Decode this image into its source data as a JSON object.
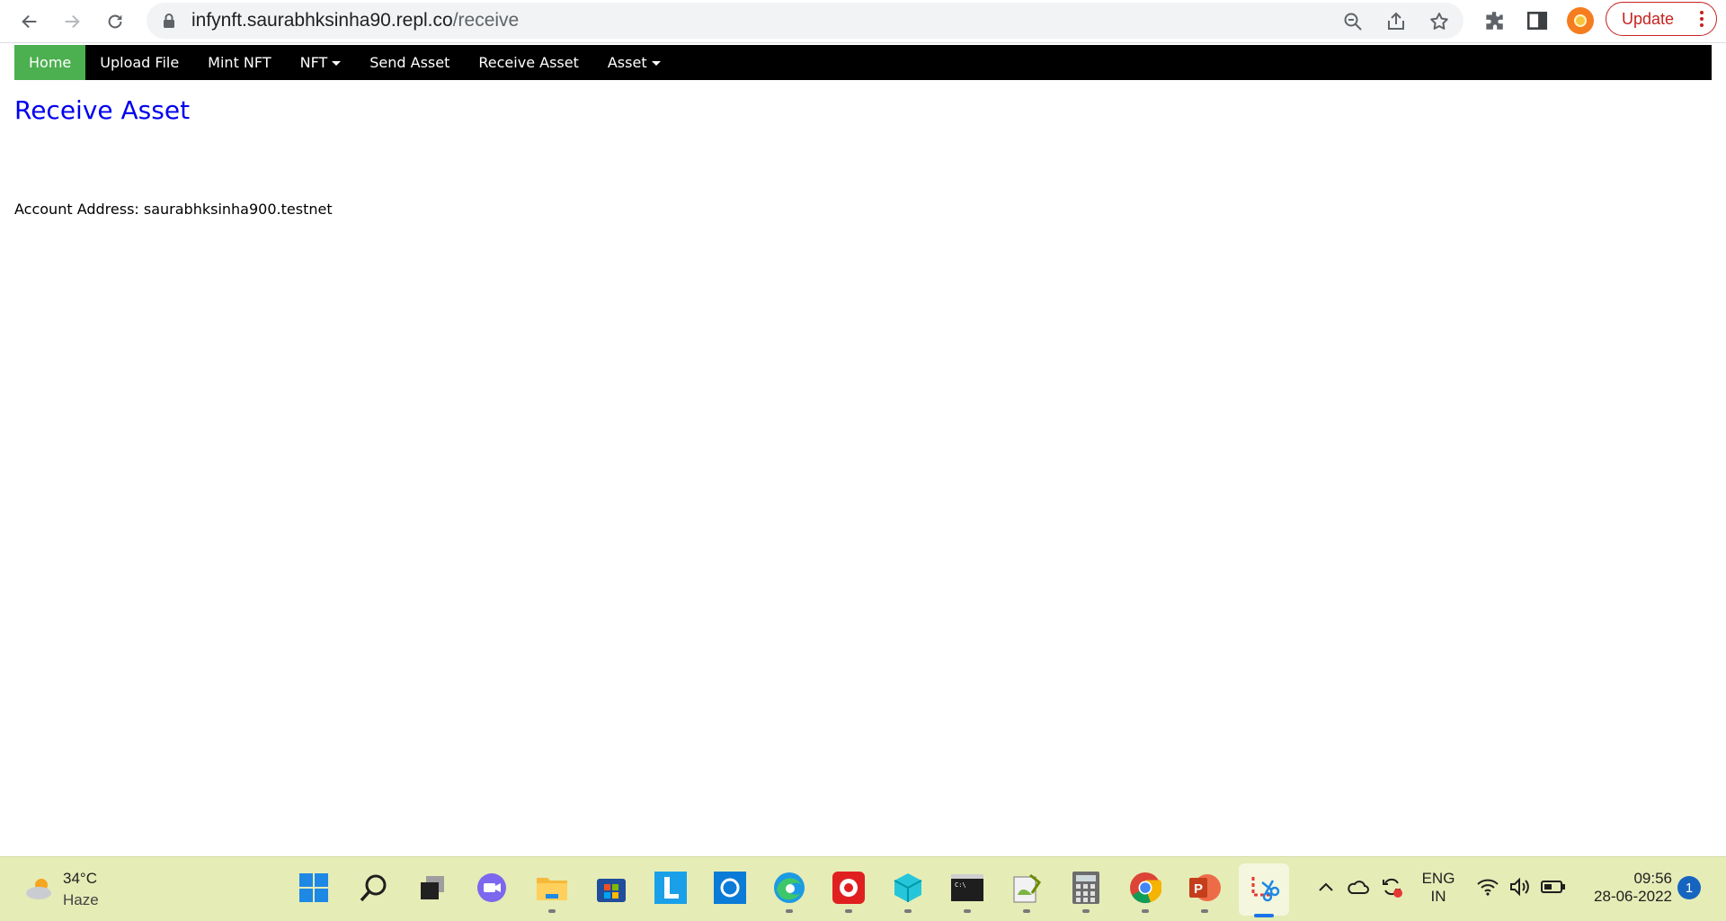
{
  "browser": {
    "url_host": "infynft.saurabhksinha90.repl.co",
    "url_path": "/receive",
    "update_label": "Update"
  },
  "nav": {
    "items": [
      {
        "label": "Home",
        "active": true
      },
      {
        "label": "Upload File"
      },
      {
        "label": "Mint NFT"
      },
      {
        "label": "NFT",
        "dropdown": true
      },
      {
        "label": "Send Asset"
      },
      {
        "label": "Receive Asset"
      },
      {
        "label": "Asset",
        "dropdown": true
      }
    ]
  },
  "page": {
    "title": "Receive Asset",
    "account_label": "Account Address:",
    "account_value": "saurabhksinha900.testnet"
  },
  "taskbar": {
    "weather": {
      "temp": "34°C",
      "condition": "Haze"
    },
    "apps": [
      "windows-start",
      "search",
      "task-view",
      "teams-chat",
      "file-explorer",
      "microsoft-store",
      "app-L",
      "cortana",
      "edge",
      "screen-recorder",
      "3d-viewer",
      "terminal",
      "notepad-plus",
      "calculator",
      "chrome",
      "powerpoint",
      "snipping-tool"
    ],
    "language": {
      "line1": "ENG",
      "line2": "IN"
    },
    "clock": {
      "time": "09:56",
      "date": "28-06-2022"
    },
    "notifications": "1"
  },
  "colors": {
    "nav_bg": "#000000",
    "nav_active": "#4caf50",
    "title_color": "#0000ee",
    "taskbar_bg": "#e6ecb6",
    "update_red": "#c5221f"
  }
}
